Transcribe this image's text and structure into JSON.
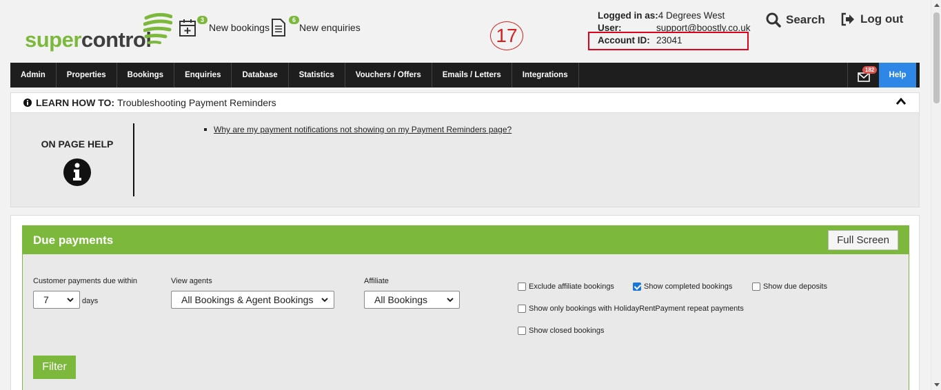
{
  "header": {
    "logo_super": "super",
    "logo_control": "control",
    "new_bookings": {
      "count": "3",
      "label": "New bookings"
    },
    "new_enquiries": {
      "count": "6",
      "label": "New enquiries"
    },
    "annotation_number": "17",
    "account": {
      "logged_in_label": "Logged in as:",
      "logged_in_value": "4 Degrees West",
      "user_label": "User:",
      "user_value": "support@boostly.co.uk",
      "account_id_label": "Account ID:",
      "account_id_value": "23041"
    },
    "search_label": "Search",
    "logout_label": "Log out",
    "highlight_color": "#e0001b"
  },
  "nav": {
    "items": [
      "Admin",
      "Properties",
      "Bookings",
      "Enquiries",
      "Database",
      "Statistics",
      "Vouchers / Offers",
      "Emails / Letters",
      "Integrations"
    ],
    "mail_count": "182",
    "help_label": "Help"
  },
  "learn": {
    "prefix": "LEARN HOW TO:",
    "title": "Troubleshooting Payment Reminders",
    "on_page_help": "ON PAGE HELP",
    "link": "Why are my payment notifications not showing on my Payment Reminders page?"
  },
  "due": {
    "title": "Due payments",
    "full_screen": "Full Screen",
    "customer_label": "Customer payments due within",
    "customer_value": "7",
    "days_label": "days",
    "agents_label": "View agents",
    "agents_value": "All Bookings & Agent Bookings",
    "affiliate_label": "Affiliate",
    "affiliate_value": "All Bookings",
    "checkboxes": {
      "exclude_affiliate": {
        "label": "Exclude affiliate bookings",
        "checked": false
      },
      "show_completed": {
        "label": "Show completed bookings",
        "checked": true
      },
      "show_due_deposits": {
        "label": "Show due deposits",
        "checked": false
      },
      "show_holiday_rent": {
        "label": "Show only bookings with HolidayRentPayment repeat payments",
        "checked": false
      },
      "show_closed": {
        "label": "Show closed bookings",
        "checked": false
      }
    },
    "filter_label": "Filter",
    "accent_color": "#7cb83c"
  }
}
